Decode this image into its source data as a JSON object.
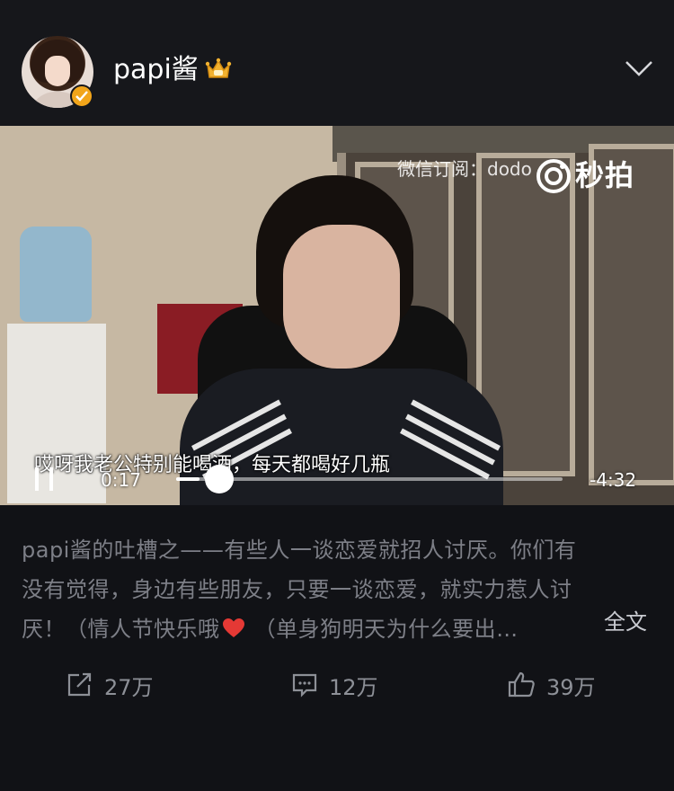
{
  "post": {
    "username": "papi酱",
    "description_lines": [
      "papi酱的吐槽之——有些人一谈恋爱就招人讨厌。你们有",
      "没有觉得，身边有些朋友，只要一谈恋爱，就实力惹人讨",
      "厌！（情人节快乐哦",
      " （单身狗明天为什么要出…"
    ],
    "more_label": "全文"
  },
  "video": {
    "watermark_text": "微信订阅：dodo",
    "logo_text": "秒拍",
    "subtitle": "哎呀我老公特别能喝酒，每天都喝好几瓶",
    "current_time": "0:17",
    "remaining_time": "-4:32",
    "progress_fraction": 0.06
  },
  "actions": {
    "share_count": "27万",
    "comment_count": "12万",
    "like_count": "39万"
  },
  "colors": {
    "background": "#111216",
    "verified_badge": "#f2a51a",
    "muted_text": "#7d7f87",
    "heart": "#e53935"
  }
}
